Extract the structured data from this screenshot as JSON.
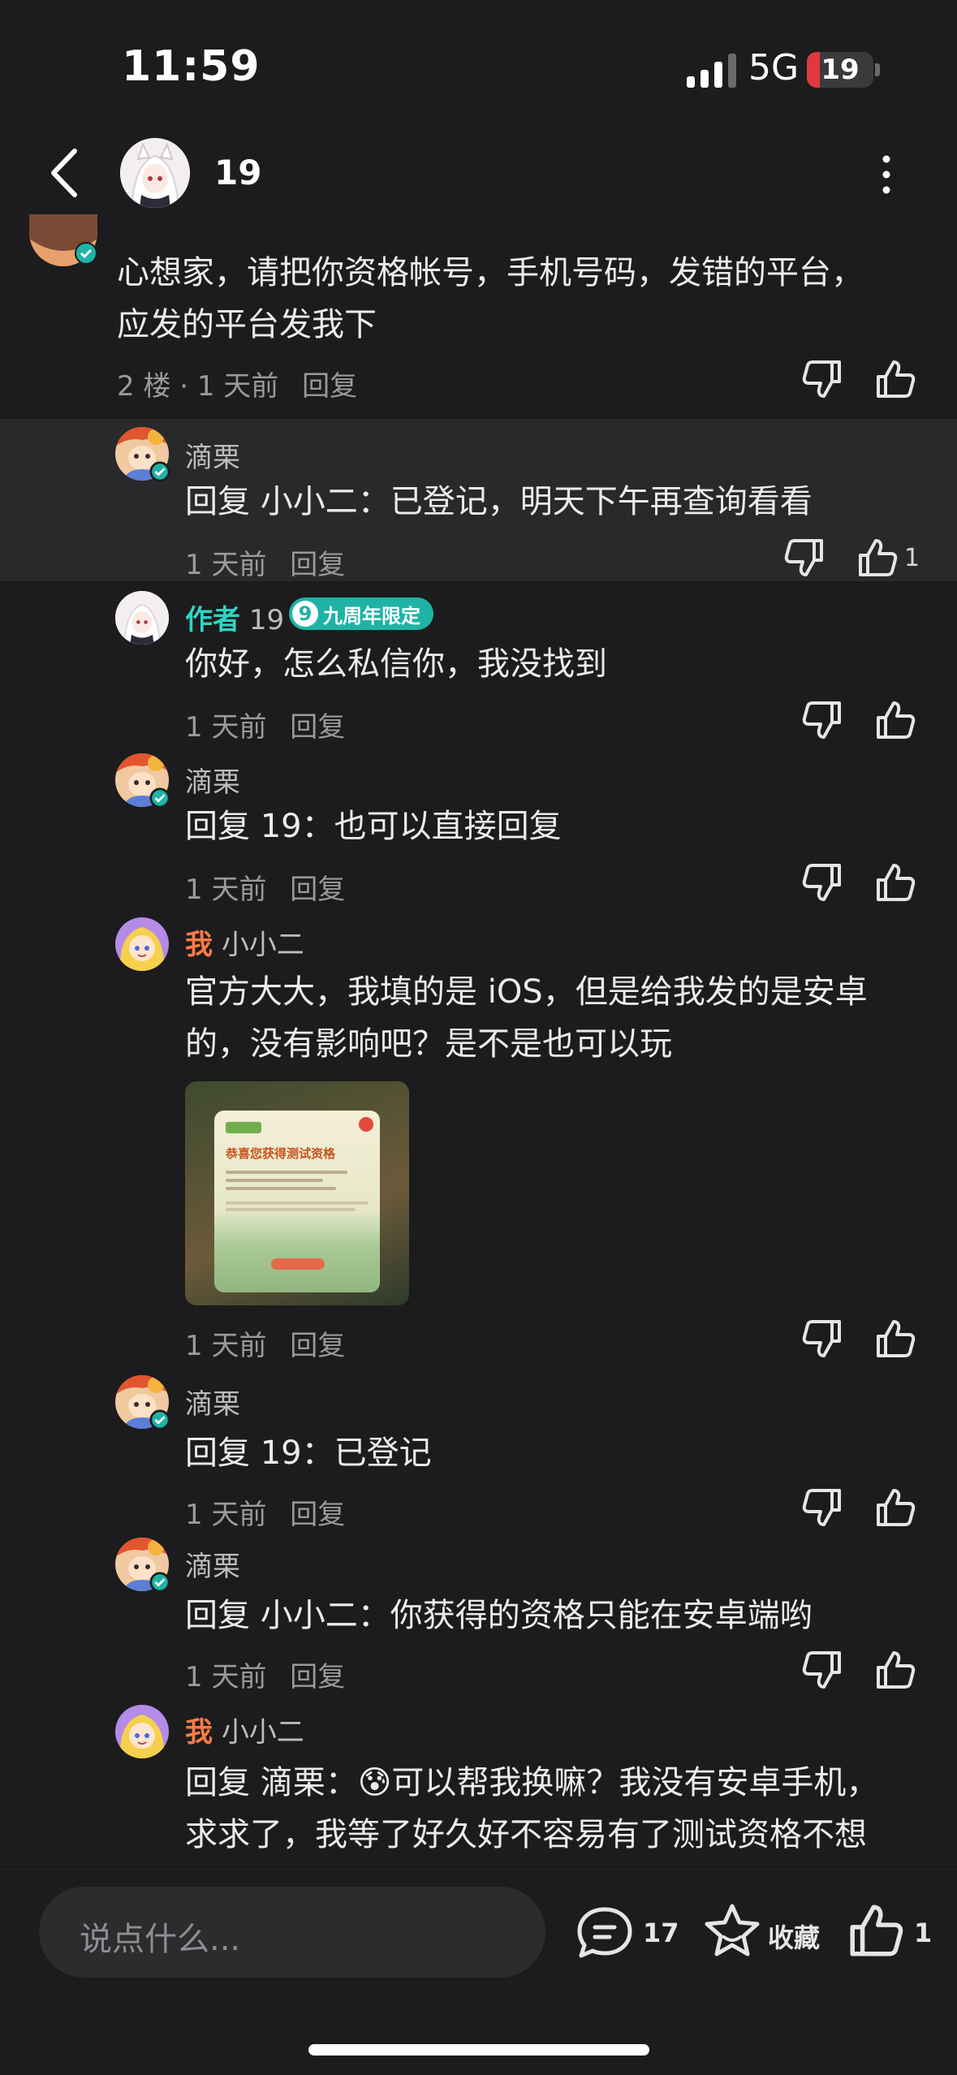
{
  "status_bar": {
    "time": "11:59",
    "network": "5G",
    "battery": "19",
    "battery_level": 0.19
  },
  "nav": {
    "title": "19"
  },
  "comments": [
    {
      "id": "c1",
      "text_lines": [
        "心想家，请把你资格帐号，手机号码，发错的平台，",
        "应发的平台发我下"
      ],
      "meta": "2 楼 · 1 天前",
      "reply": "回复"
    },
    {
      "id": "c2",
      "name": "滴栗",
      "text_lines": [
        "回复 小小二：已登记，明天下午再查询看看"
      ],
      "time": "1 天前",
      "reply": "回复",
      "likes": "1"
    },
    {
      "id": "c3",
      "author_tag": "作者",
      "name": "19",
      "badge_num": "9",
      "badge": "九周年限定",
      "text_lines": [
        "你好，怎么私信你，我没找到"
      ],
      "time": "1 天前",
      "reply": "回复"
    },
    {
      "id": "c4",
      "name": "滴栗",
      "text_lines": [
        "回复 19：也可以直接回复"
      ],
      "time": "1 天前",
      "reply": "回复"
    },
    {
      "id": "c5",
      "me_tag": "我",
      "name": "小小二",
      "text_lines": [
        "官方大大，我填的是 iOS，但是给我发的是安卓",
        "的，没有影响吧？是不是也可以玩"
      ],
      "image_title": "恭喜您获得测试资格",
      "time": "1 天前",
      "reply": "回复"
    },
    {
      "id": "c6",
      "name": "滴栗",
      "text_lines": [
        "回复 19：已登记"
      ],
      "time": "1 天前",
      "reply": "回复"
    },
    {
      "id": "c7",
      "name": "滴栗",
      "text_lines": [
        "回复 小小二：你获得的资格只能在安卓端哟"
      ],
      "time": "1 天前",
      "reply": "回复"
    },
    {
      "id": "c8",
      "me_tag": "我",
      "name": "小小二",
      "text_lines": [
        "回复 滴栗：😰可以帮我换嘛？我没有安卓手机，",
        "求求了，我等了好久好不容易有了测试资格不想"
      ]
    }
  ],
  "bottom_bar": {
    "placeholder": "说点什么...",
    "comment_count": "17",
    "favorite_label": "收藏",
    "like_count": "1"
  },
  "colors": {
    "background": "#1c1c1e",
    "highlight": "#29292b",
    "author": "#2fd4c5",
    "me": "#ff7a45",
    "battery": "#e0383e"
  }
}
